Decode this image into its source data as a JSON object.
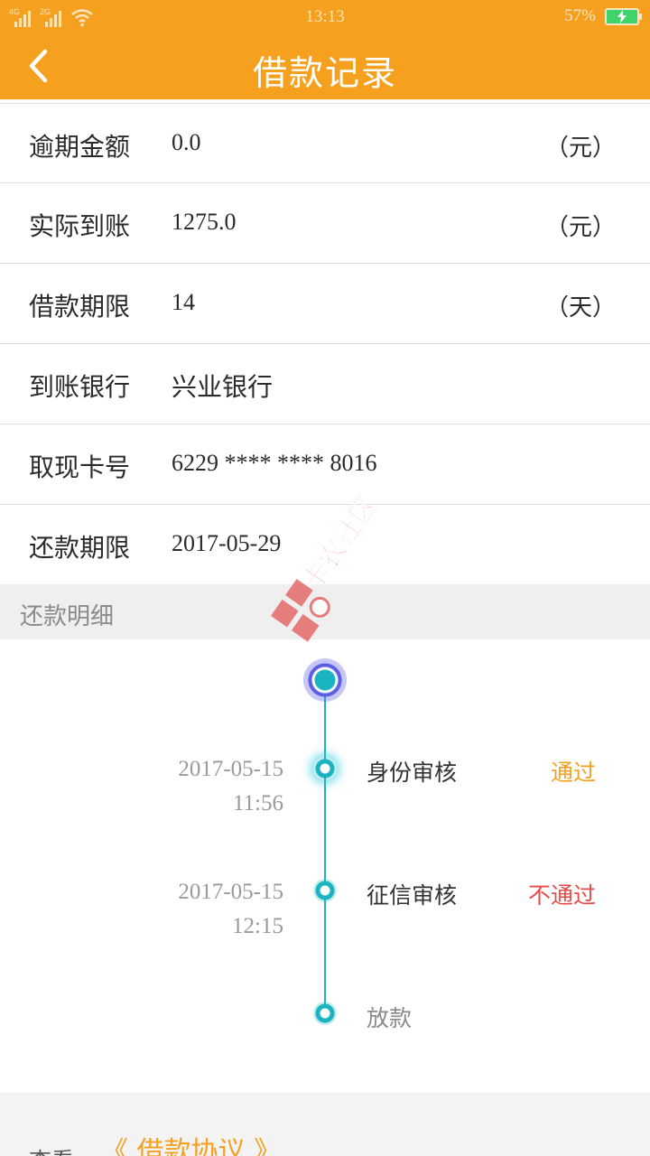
{
  "status_bar": {
    "network_1": "4G",
    "network_2": "2G",
    "time": "13:13",
    "battery": "57%"
  },
  "header": {
    "title": "借款记录",
    "back_icon": "chevron-left-icon"
  },
  "info_rows": [
    {
      "label": "逾期金额",
      "value": "0.0",
      "unit": "（元）"
    },
    {
      "label": "实际到账",
      "value": "1275.0",
      "unit": "（元）"
    },
    {
      "label": "借款期限",
      "value": "14",
      "unit": "（天）"
    },
    {
      "label": "到账银行",
      "value": "兴业银行",
      "unit": ""
    },
    {
      "label": "取现卡号",
      "value": "6229 **** **** 8016",
      "unit": ""
    },
    {
      "label": "还款期限",
      "value": "2017-05-29",
      "unit": ""
    }
  ],
  "repayment_section": {
    "title": "还款明细"
  },
  "timeline": [
    {
      "date": "2017-05-15",
      "time": "11:56",
      "step": "身份审核",
      "result": "通过",
      "result_color": "#f5a11f"
    },
    {
      "date": "2017-05-15",
      "time": "12:15",
      "step": "征信审核",
      "result": "不通过",
      "result_color": "#e84a4a"
    },
    {
      "date": "",
      "time": "",
      "step": "放款",
      "result": "",
      "result_color": ""
    }
  ],
  "footer": {
    "view_label": "查看",
    "agreement_link": "《 借款协议 》"
  },
  "watermark": {
    "text": "卡农社区"
  },
  "colors": {
    "brand": "#f5a11f",
    "timeline": "#19b4c0",
    "fail": "#e84a4a"
  }
}
